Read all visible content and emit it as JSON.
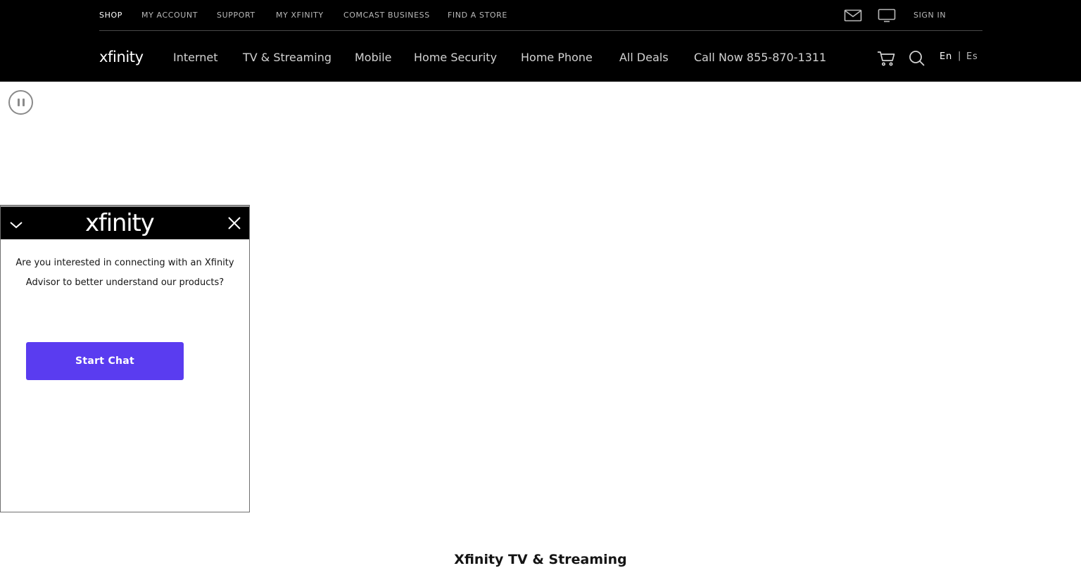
{
  "utility_nav": {
    "items": [
      {
        "label": "SHOP",
        "active": true
      },
      {
        "label": "MY ACCOUNT",
        "active": false
      },
      {
        "label": "SUPPORT",
        "active": false
      },
      {
        "label": "MY XFINITY",
        "active": false
      },
      {
        "label": "COMCAST BUSINESS",
        "active": false
      },
      {
        "label": "FIND A STORE",
        "active": false
      }
    ],
    "icons": [
      "mail-icon",
      "tv-icon"
    ],
    "sign_in": "SIGN IN"
  },
  "main_nav": {
    "logo": "xfinity",
    "items": [
      {
        "label": "Internet"
      },
      {
        "label": "TV & Streaming"
      },
      {
        "label": "Mobile"
      },
      {
        "label": "Home Security"
      },
      {
        "label": "Home Phone"
      },
      {
        "label": "All Deals"
      },
      {
        "label": "Call Now 855-870-1311"
      }
    ],
    "icons": [
      "cart-icon",
      "search-icon"
    ],
    "languages": {
      "en": "En",
      "separator": "|",
      "es": "Es"
    }
  },
  "media": {
    "pause_icon": "pause-icon"
  },
  "chat": {
    "logo": "xfinity",
    "message": "Are you interested in connecting with an Xfinity Advisor to better understand our products?",
    "button_label": "Start Chat",
    "button_color": "#5a3cf0"
  },
  "section": {
    "title": "Xfinity TV & Streaming"
  },
  "colors": {
    "header_bg": "#000000",
    "accent": "#5a3cf0"
  }
}
